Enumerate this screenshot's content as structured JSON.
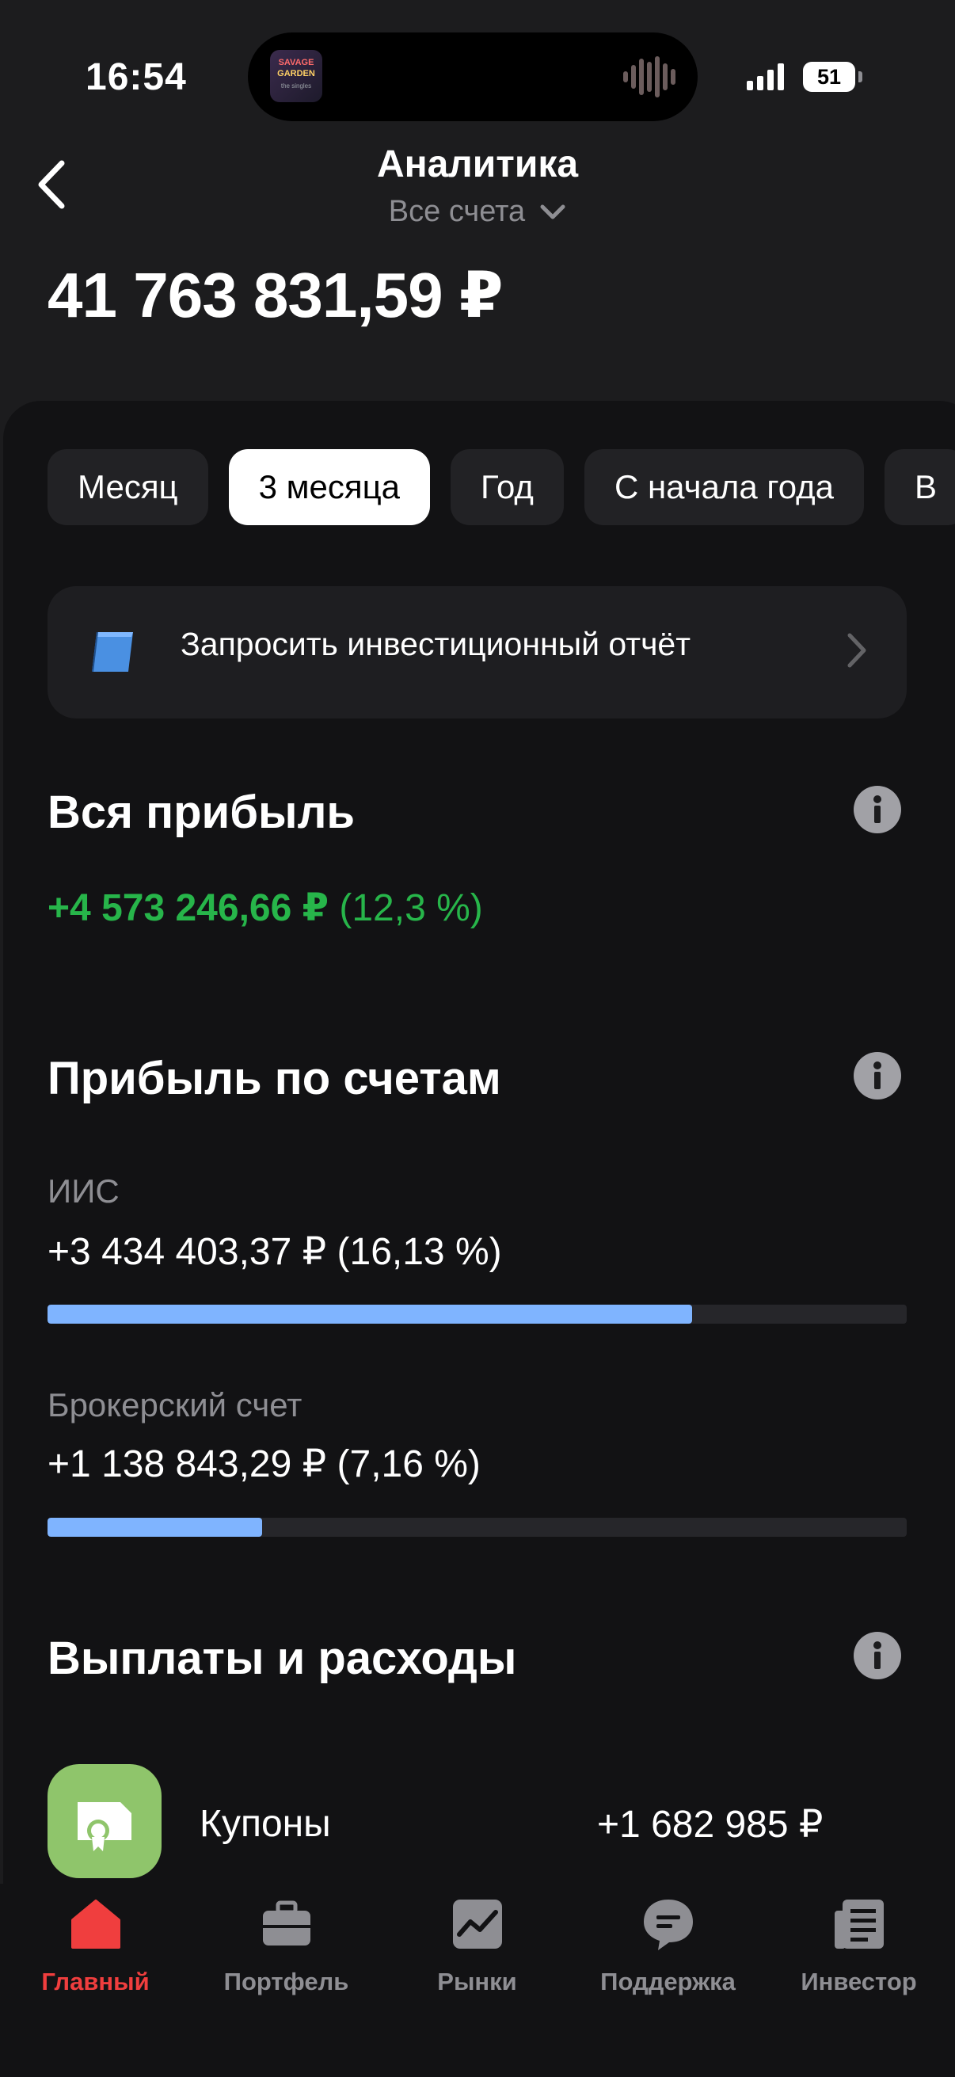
{
  "status_bar": {
    "time": "16:54",
    "now_playing_art": [
      "SAVAGE",
      "GARDEN",
      "the singles"
    ],
    "battery": "51"
  },
  "header": {
    "title": "Аналитика",
    "subtitle": "Все счета",
    "total": "41 763 831,59 ₽"
  },
  "periods": [
    {
      "label": "Месяц",
      "active": false
    },
    {
      "label": "3 месяца",
      "active": true
    },
    {
      "label": "Год",
      "active": false
    },
    {
      "label": "С начала года",
      "active": false
    },
    {
      "label": "В",
      "active": false
    }
  ],
  "report": {
    "label": "Запросить инвестиционный отчёт",
    "icon": "book-icon"
  },
  "total_profit": {
    "heading": "Вся прибыль",
    "amount": "+4 573 246,66 ₽",
    "percent": "(12,3 %)"
  },
  "accounts": {
    "heading": "Прибыль по счетам",
    "items": [
      {
        "name": "ИИС",
        "value": "+3 434 403,37 ₽ (16,13 %)",
        "share": 0.75
      },
      {
        "name": "Брокерский счет",
        "value": "+1 138 843,29 ₽ (7,16 %)",
        "share": 0.25
      }
    ]
  },
  "payouts": {
    "heading": "Выплаты и расходы",
    "items": [
      {
        "label": "Купоны",
        "amount": "+1 682 985 ₽",
        "icon": "coupon-icon"
      }
    ]
  },
  "nav": [
    {
      "label": "Главный",
      "icon": "home-icon",
      "active": true
    },
    {
      "label": "Портфель",
      "icon": "briefcase-icon",
      "active": false
    },
    {
      "label": "Рынки",
      "icon": "chart-icon",
      "active": false
    },
    {
      "label": "Поддержка",
      "icon": "chat-icon",
      "active": false
    },
    {
      "label": "Инвестор",
      "icon": "news-icon",
      "active": false
    }
  ],
  "colors": {
    "background": "#1c1c1e",
    "sheet": "#121214",
    "profit_green": "#27b54a",
    "bar_blue": "#7fb4ff",
    "nav_active_red": "#f03e3e",
    "coupon_green": "#8fc56b"
  }
}
